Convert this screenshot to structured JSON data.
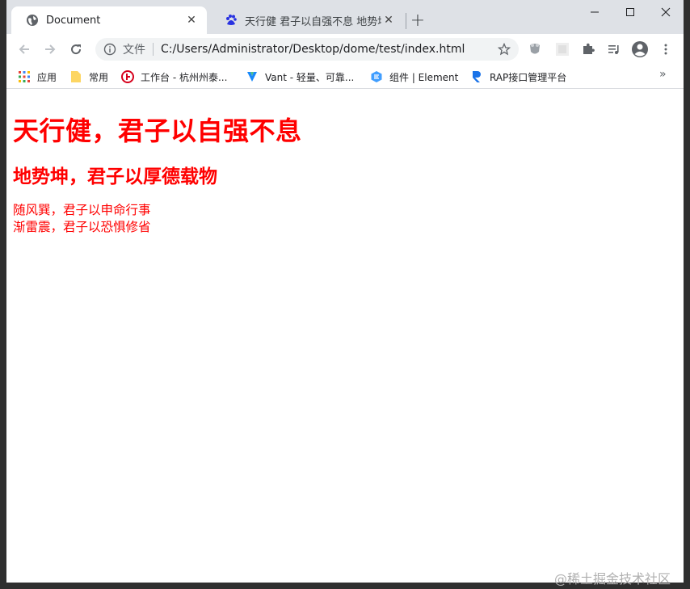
{
  "tabs": [
    {
      "title": "Document",
      "icon": "globe-icon",
      "close": "✕"
    },
    {
      "title": "天行健 君子以自强不息 地势坤 君",
      "icon": "baidu-paw-icon",
      "close": "✕"
    }
  ],
  "new_tab": "+",
  "window_controls": {
    "minimize": "—",
    "maximize": "☐",
    "close": "✕"
  },
  "toolbar": {
    "scheme_label": "文件",
    "url": "C:/Users/Administrator/Desktop/dome/test/index.html"
  },
  "bookmarks": [
    {
      "label": "应用",
      "icon": "apps-grid-icon"
    },
    {
      "label": "常用",
      "icon": "folder-icon"
    },
    {
      "label": "工作台 - 杭州州泰...",
      "icon": "workbench-icon"
    },
    {
      "label": "Vant - 轻量、可靠...",
      "icon": "vant-icon"
    },
    {
      "label": "组件 | Element",
      "icon": "element-icon"
    },
    {
      "label": "RAP接口管理平台",
      "icon": "rap-icon"
    }
  ],
  "bookmarks_more": "»",
  "page": {
    "h1": "天行健，君子以自强不息",
    "h2": "地势坤，君子以厚德载物",
    "lines": [
      "随风巽，君子以申命行事",
      "渐雷震，君子以恐惧修省"
    ]
  },
  "watermark": "@稀土掘金技术社区",
  "colors": {
    "text_accent": "#ff0000",
    "tabstrip": "#dee1e6",
    "omnibox": "#f1f3f4"
  }
}
